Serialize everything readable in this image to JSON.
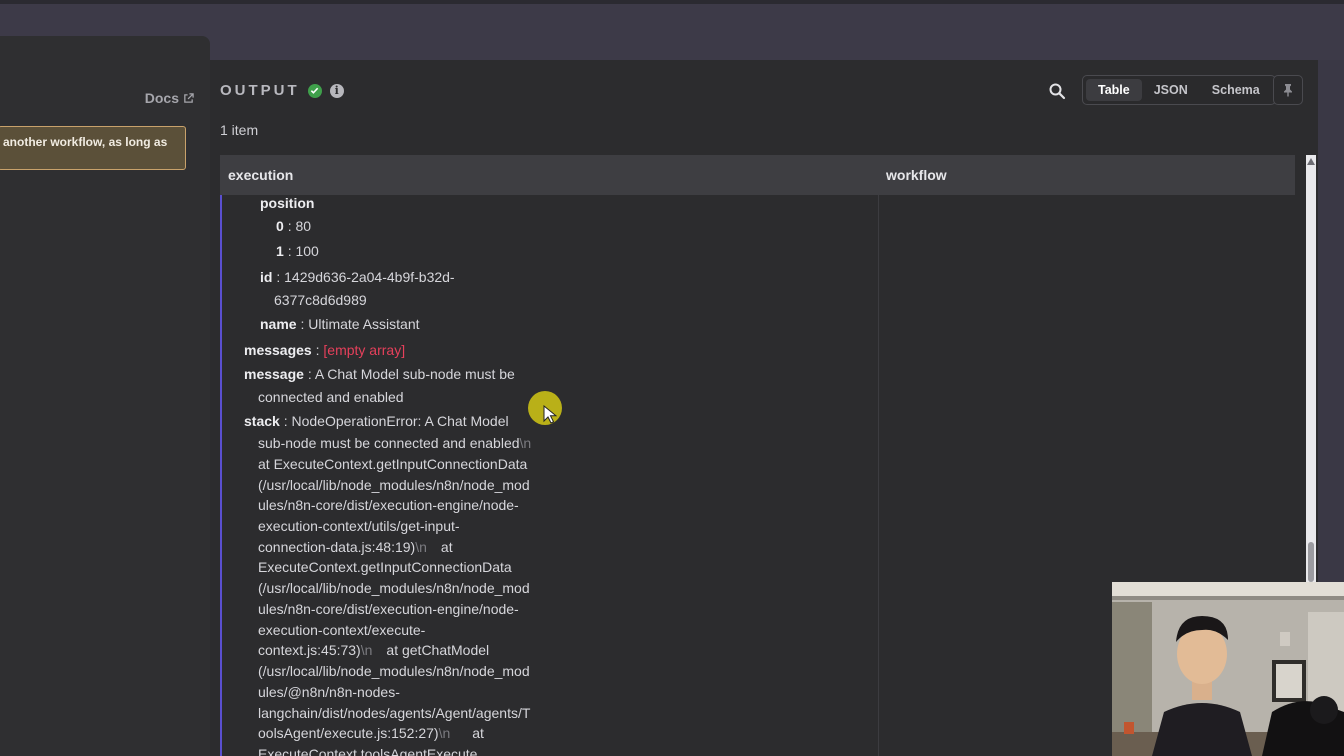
{
  "params_panel": {
    "docs_label": "Docs",
    "notice_text": "another workflow, as long as"
  },
  "output": {
    "title": "OUTPUT",
    "item_count": "1 item",
    "view_tabs": [
      "Table",
      "JSON",
      "Schema"
    ],
    "active_view": "Table"
  },
  "table": {
    "columns": [
      "execution",
      "workflow"
    ],
    "rows": {
      "position_key": "position",
      "pos0_key": "0",
      "pos0_val": ": 80",
      "pos1_key": "1",
      "pos1_val": ": 100",
      "id_key": "id",
      "id_val_1": ": 1429d636-2a04-4b9f-b32d-",
      "id_val_2": "6377c8d6d989",
      "name_key": "name",
      "name_val": ": Ultimate Assistant",
      "messages_key": "messages",
      "messages_sep": " : ",
      "messages_val": "[empty array]",
      "message_key": "message",
      "message_val_1": ": A Chat Model sub-node must be",
      "message_val_2": "connected and enabled",
      "stack_key": "stack",
      "stack_first": ": NodeOperationError: A Chat Model",
      "stack_lines": [
        "sub-node must be connected and enabled",
        "at ExecuteContext.getInputConnectionData",
        "(/usr/local/lib/node_modules/n8n/node_mod",
        "ules/n8n-core/dist/execution-engine/node-",
        "execution-context/utils/get-input-",
        "connection-data.js:48:19)",
        "ExecuteContext.getInputConnectionData",
        "(/usr/local/lib/node_modules/n8n/node_mod",
        "ules/n8n-core/dist/execution-engine/node-",
        "execution-context/execute-",
        "context.js:45:73)",
        "(/usr/local/lib/node_modules/n8n/node_mod",
        "ules/@n8n/n8n-nodes-",
        "langchain/dist/nodes/agents/Agent/agents/T",
        "oolsAgent/execute.js:152:27)",
        "ExecuteContext.toolsAgentExecute"
      ],
      "newline_token": "\\n",
      "at_token": "at",
      "at_getchatmodel": "at getChatModel"
    }
  },
  "colors": {
    "accent": "#5a4fd0",
    "success": "#3fa04b",
    "empty_array": "#e5405b"
  }
}
